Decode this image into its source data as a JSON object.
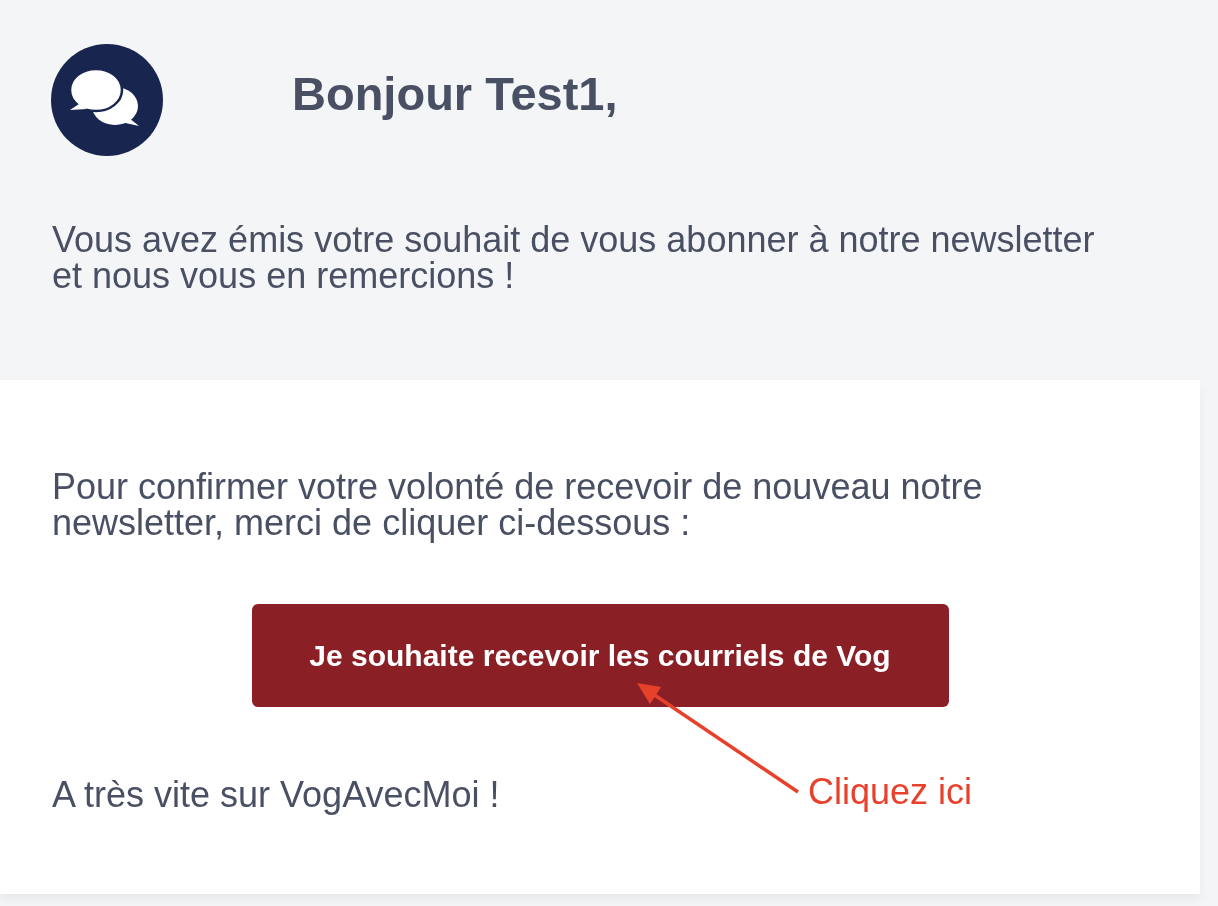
{
  "greeting": "Bonjour Test1,",
  "intro": "Vous avez émis votre souhait de vous abonner à notre newsletter et nous vous en remercions !",
  "card": {
    "message": "Pour confirmer votre volonté de recevoir de nouveau notre newsletter, merci de cliquer ci-dessous :",
    "button": "Je souhaite recevoir les courriels de Vog",
    "closing": "A très vite sur VogAvecMoi !"
  },
  "annotation": {
    "label": "Cliquez ici"
  }
}
